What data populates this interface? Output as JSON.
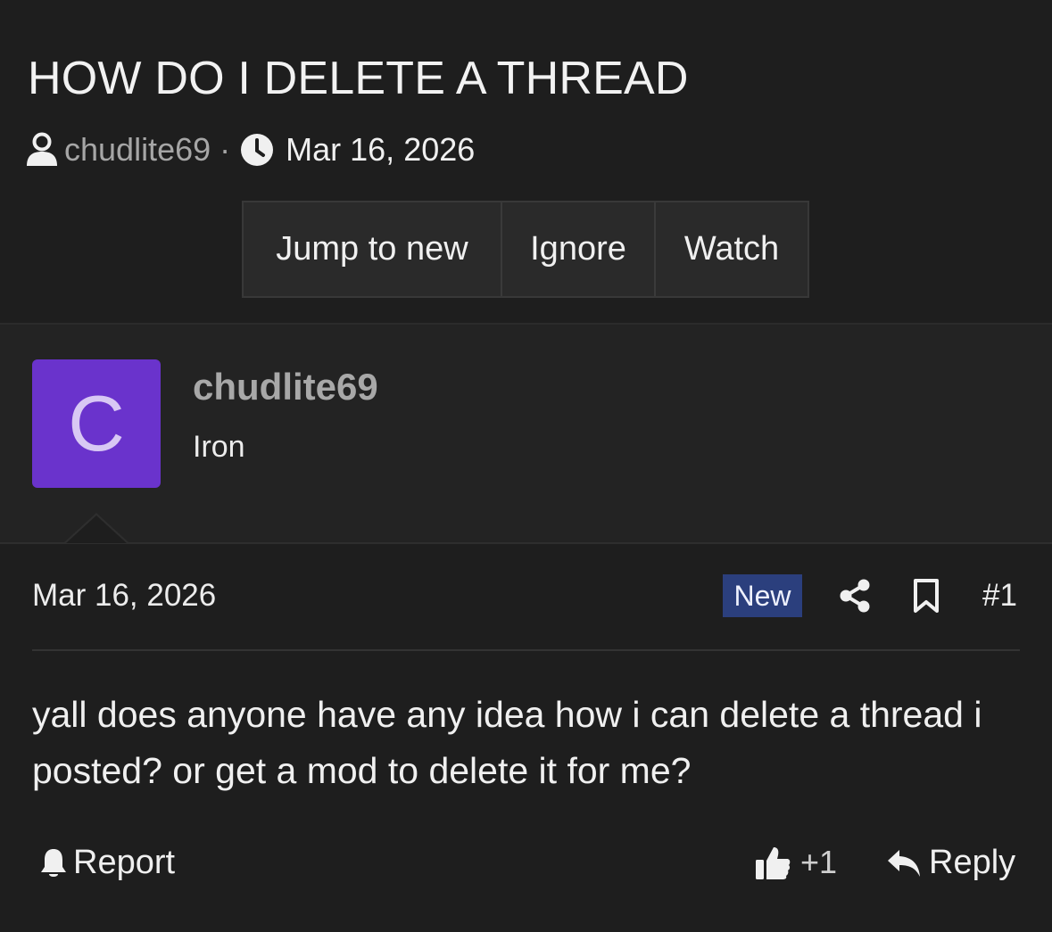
{
  "thread": {
    "title": "HOW DO I DELETE A THREAD",
    "author": "chudlite69",
    "separator": "·",
    "date": "Mar 16, 2026"
  },
  "actions": {
    "jump_label": "Jump to new",
    "ignore_label": "Ignore",
    "watch_label": "Watch"
  },
  "post": {
    "avatar_letter": "C",
    "avatar_color": "#6a33cc",
    "username": "chudlite69",
    "user_title": "Iron",
    "date": "Mar 16, 2026",
    "badge": "New",
    "number": "#1",
    "body": "yall does anyone have any idea how i can delete a thread i posted? or get a mod to delete it for me?",
    "report_label": "Report",
    "like_count": "+1",
    "reply_label": "Reply"
  },
  "icons": {
    "author": "user-icon",
    "time": "clock-icon",
    "share": "share-icon",
    "bookmark": "bookmark-icon",
    "report": "bell-icon",
    "like": "thumbs-up-icon",
    "reply": "reply-icon"
  }
}
